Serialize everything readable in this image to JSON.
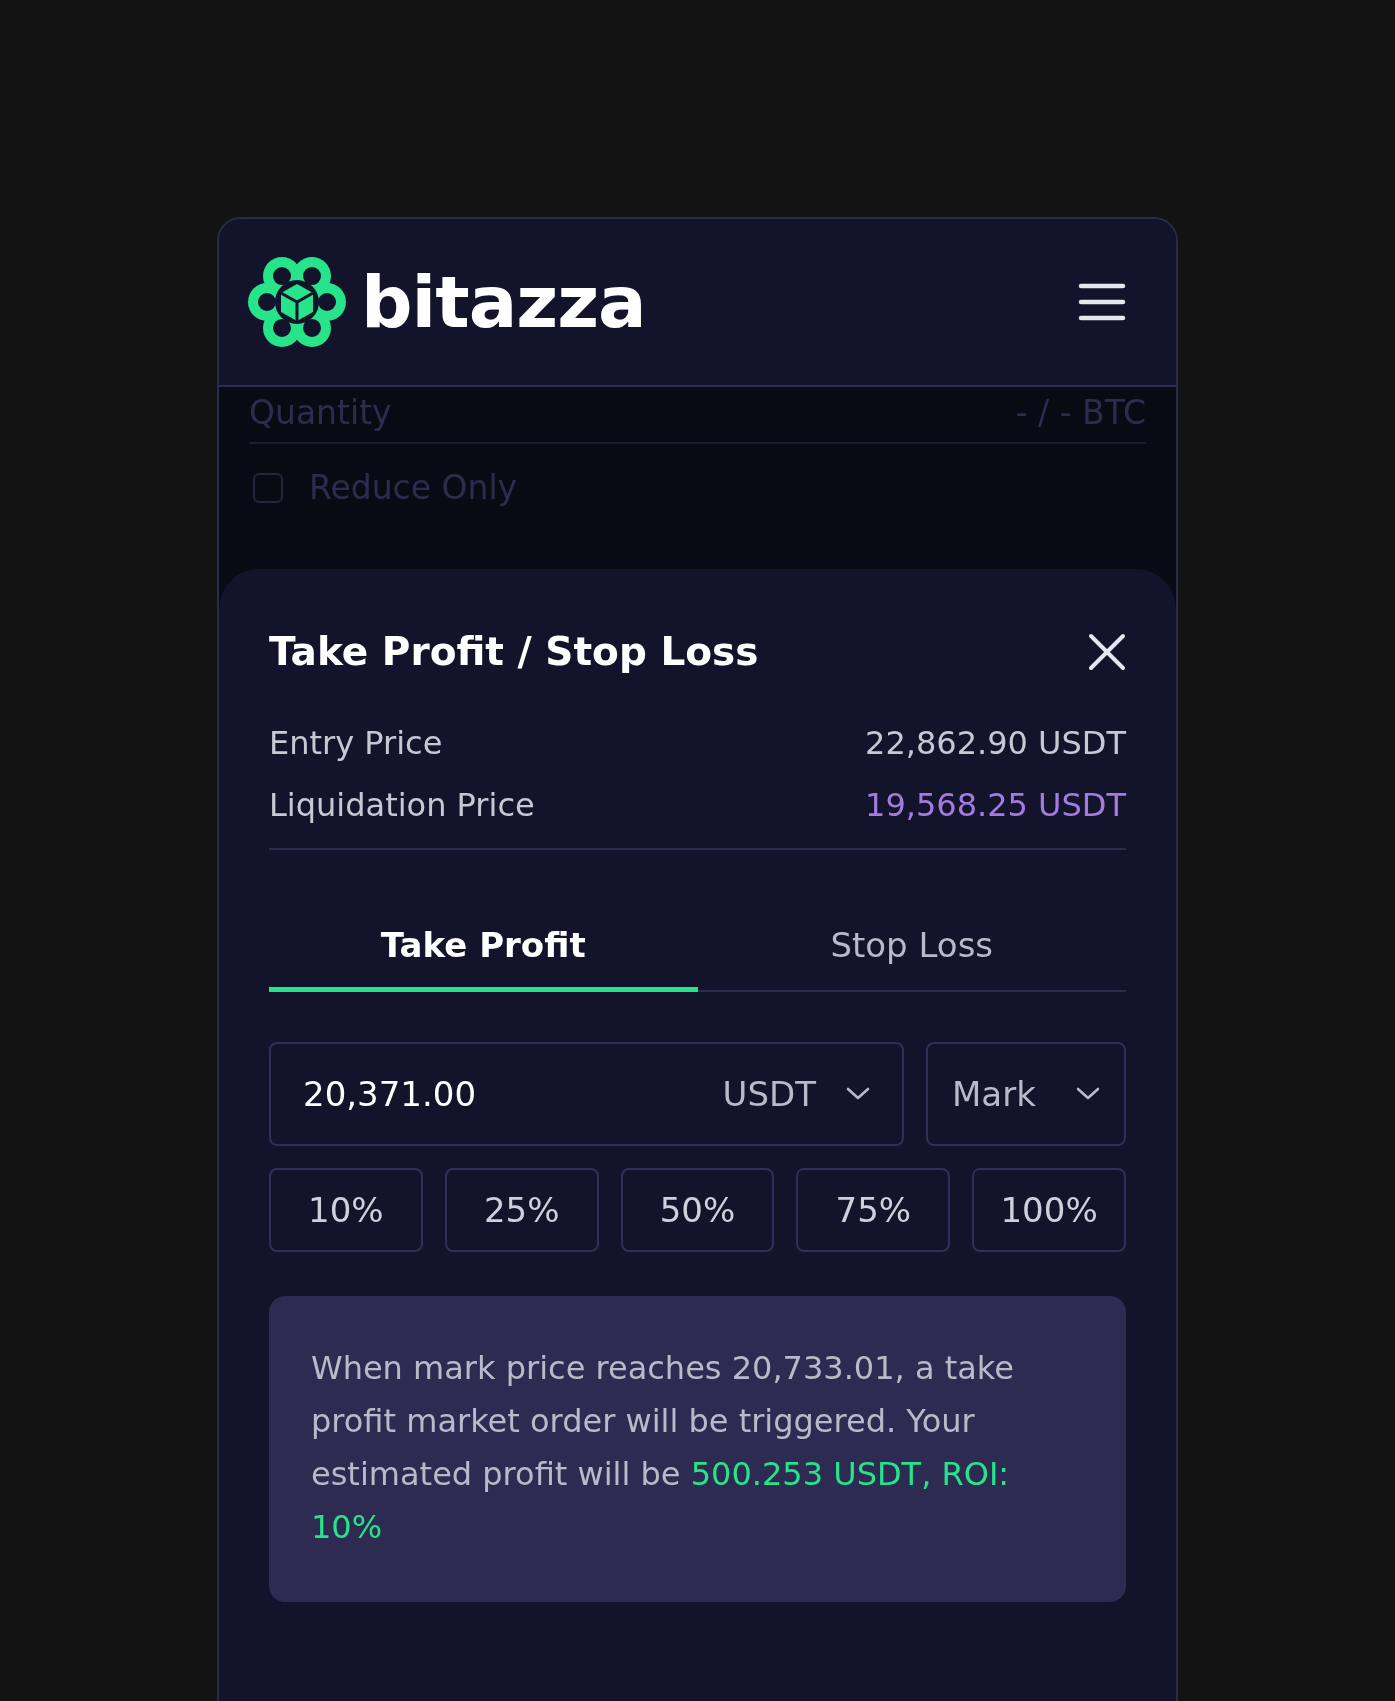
{
  "header": {
    "logo_text": "bitazza"
  },
  "background_form": {
    "quantity_label": "Quantity",
    "quantity_value": "- / - BTC",
    "reduce_only": {
      "label": "Reduce Only",
      "checked": false
    }
  },
  "sheet": {
    "title": "Take Profit / Stop Loss",
    "prices": [
      {
        "label": "Entry Price",
        "value": "22,862.90 USDT",
        "kind": "normal"
      },
      {
        "label": "Liquidation Price",
        "value": "19,568.25 USDT",
        "kind": "liquidation"
      }
    ],
    "tabs": [
      {
        "label": "Take Profit",
        "selected": true
      },
      {
        "label": "Stop Loss",
        "selected": false
      }
    ],
    "price_input": {
      "value": "20,371.00",
      "unit": "USDT"
    },
    "trigger_select": {
      "value": "Mark"
    },
    "percent_buttons": [
      "10%",
      "25%",
      "50%",
      "75%",
      "100%"
    ],
    "info": "When mark price reaches 20,733.01, a take profit market order will be triggered. Your estimated profit will be **500.253 USDT, ROI: 10%**"
  }
}
